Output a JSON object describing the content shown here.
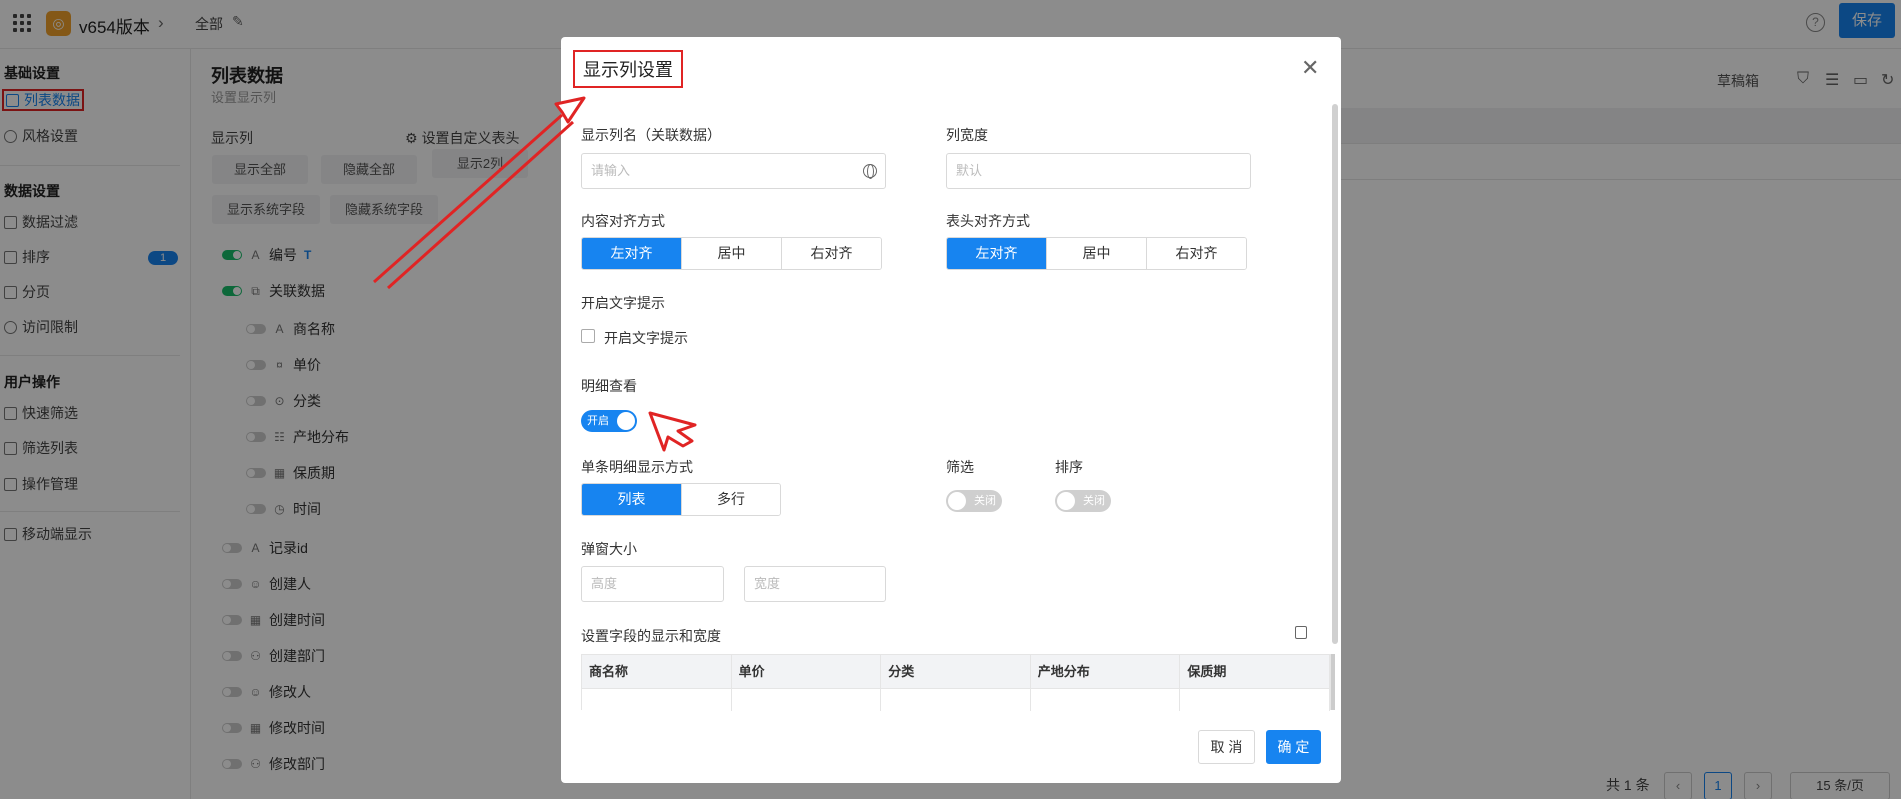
{
  "topbar": {
    "app_name": "v654版本",
    "breadcrumb": "全部",
    "save_label": "保存",
    "help_glyph": "?",
    "chevron_glyph": "›",
    "edit_glyph": "✎",
    "logo_glyph": "◎"
  },
  "sidebar": {
    "group1": "基础设置",
    "item_list_data": "列表数据",
    "item_style": "风格设置",
    "group2": "数据设置",
    "item_filter": "数据过滤",
    "item_sort": "排序",
    "sort_badge": "1",
    "item_paging": "分页",
    "item_access": "访问限制",
    "group3": "用户操作",
    "item_quick_filter": "快速筛选",
    "item_filter_list": "筛选列表",
    "item_action_mgmt": "操作管理",
    "item_mobile": "移动端显示"
  },
  "middle": {
    "title": "列表数据",
    "subtitle": "设置显示列",
    "display_cols_label": "显示列",
    "custom_header_link": "设置自定义表头",
    "btn_show_all": "显示全部",
    "btn_hide_all": "隐藏全部",
    "btn_show_n": "显示2列",
    "btn_show_sys": "显示系统字段",
    "btn_hide_sys": "隐藏系统字段",
    "fields": [
      {
        "label": "编号",
        "type_icon": "A",
        "tag": "T"
      },
      {
        "label": "关联数据",
        "type_icon": "⧉"
      },
      {
        "label": "商名称",
        "type_icon": "A"
      },
      {
        "label": "单价",
        "type_icon": "¤"
      },
      {
        "label": "分类",
        "type_icon": "⊙"
      },
      {
        "label": "产地分布",
        "type_icon": "☷"
      },
      {
        "label": "保质期",
        "type_icon": "▦"
      },
      {
        "label": "时间",
        "type_icon": "◷"
      },
      {
        "label": "记录id",
        "type_icon": "A"
      },
      {
        "label": "创建人",
        "type_icon": "☺"
      },
      {
        "label": "创建时间",
        "type_icon": "▦"
      },
      {
        "label": "创建部门",
        "type_icon": "⚇"
      },
      {
        "label": "修改人",
        "type_icon": "☺"
      },
      {
        "label": "修改时间",
        "type_icon": "▦"
      },
      {
        "label": "修改部门",
        "type_icon": "⚇"
      }
    ]
  },
  "right": {
    "draft_label": "草稿箱",
    "pager_total": "共 1 条",
    "pager_page": "1",
    "pager_size": "15 条/页",
    "prev_glyph": "‹",
    "next_glyph": "›"
  },
  "modal": {
    "title": "显示列设置",
    "close_glyph": "✕",
    "col_name_label": "显示列名（关联数据）",
    "col_name_placeholder": "请输入",
    "col_width_label": "列宽度",
    "col_width_placeholder": "默认",
    "content_align_label": "内容对齐方式",
    "header_align_label": "表头对齐方式",
    "align_left": "左对齐",
    "align_center": "居中",
    "align_right": "右对齐",
    "text_tip_label": "开启文字提示",
    "text_tip_checkbox": "开启文字提示",
    "detail_label": "明细查看",
    "detail_toggle": "开启",
    "single_detail_label": "单条明细显示方式",
    "mode_list": "列表",
    "mode_multi": "多行",
    "filter_label": "筛选",
    "filter_toggle": "关闭",
    "sort_label": "排序",
    "sort_toggle": "关闭",
    "popup_size_label": "弹窗大小",
    "height_placeholder": "高度",
    "width_placeholder": "宽度",
    "field_display_label": "设置字段的显示和宽度",
    "grid_columns": [
      "商名称",
      "单价",
      "分类",
      "产地分布",
      "保质期"
    ],
    "cancel": "取 消",
    "ok": "确 定"
  },
  "colors": {
    "primary": "#1784f0",
    "annotation_red": "#e02424",
    "toggle_green": "#19be6b",
    "overlay": "rgba(0,0,0,0.45)"
  }
}
